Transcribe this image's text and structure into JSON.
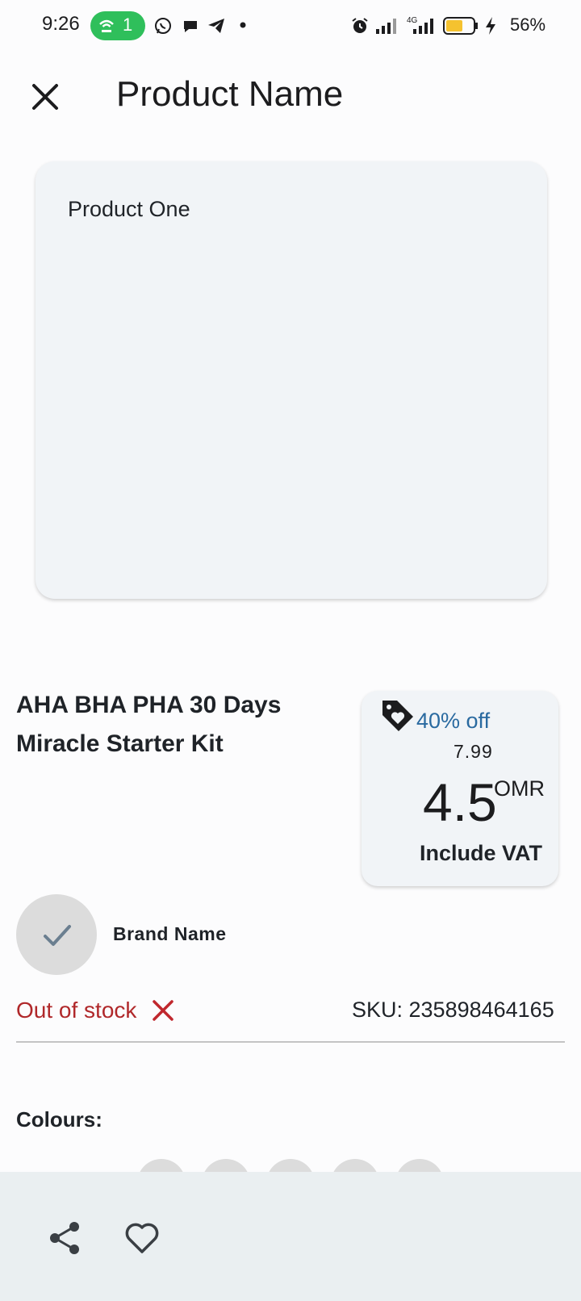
{
  "status_bar": {
    "time": "9:26",
    "hotspot_count": "1",
    "battery": "56%"
  },
  "app_bar": {
    "title": "Product Name"
  },
  "image_card": {
    "label": "Product One"
  },
  "product": {
    "name": "AHA BHA PHA 30 Days Miracle Starter Kit"
  },
  "price_card": {
    "discount": "40% off",
    "old_price": "7.99",
    "price": "4.5",
    "currency": "OMR",
    "vat_note": "Include VAT"
  },
  "brand": {
    "name": "Brand Name"
  },
  "stock": {
    "status": "Out of stock",
    "sku": "SKU: 235898464165"
  },
  "colours": {
    "label": "Colours:"
  },
  "colors": {
    "accent_blue": "#2a6aa0",
    "out_of_stock_red": "#b0282a",
    "card_bg": "#f1f4f7",
    "bottom_bar_bg": "#eaeff1"
  }
}
